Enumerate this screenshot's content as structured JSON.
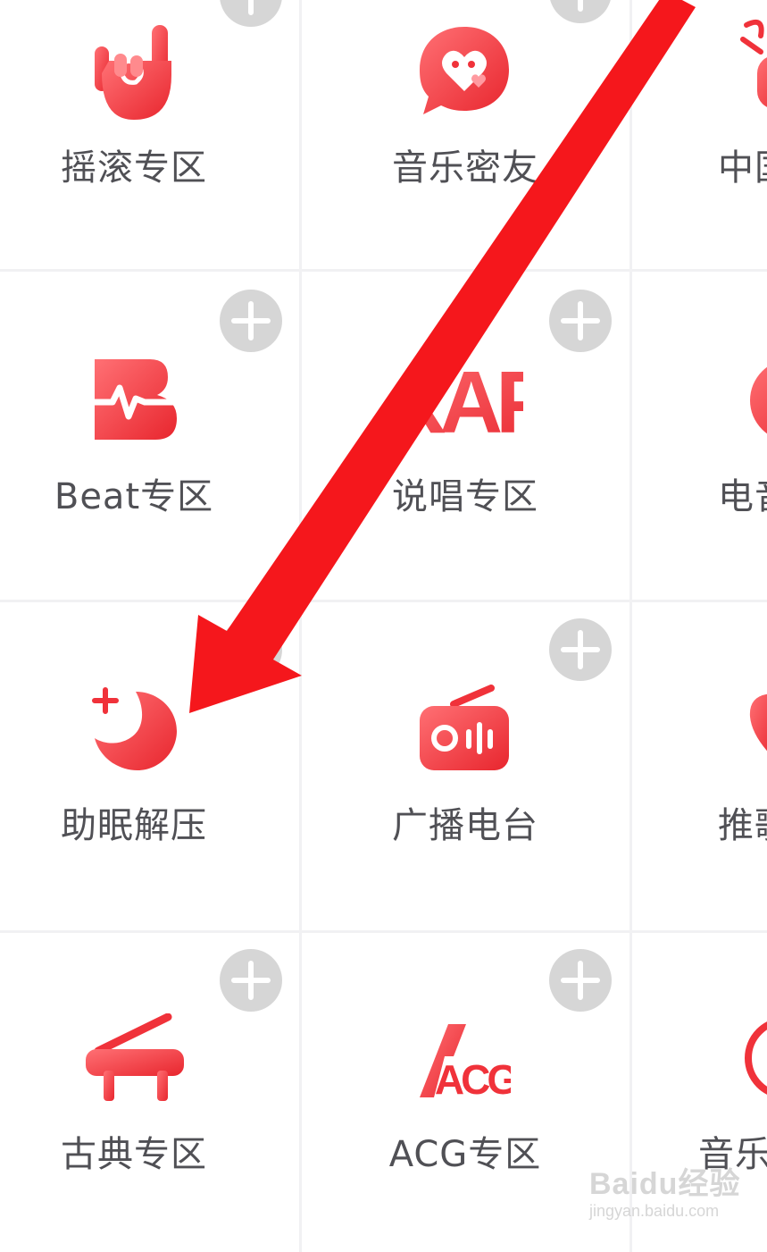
{
  "colors": {
    "accent": "#f0323a",
    "icon_gradient_light": "#ff6b6f",
    "icon_gradient_dark": "#e8262e",
    "add_button": "#d6d6d6",
    "label": "#505055",
    "arrow": "#f5171c"
  },
  "tiles": [
    {
      "label": "摇滚专区",
      "icon": "rock-hand-icon"
    },
    {
      "label": "音乐密友",
      "icon": "heart-chat-icon"
    },
    {
      "label": "中国",
      "icon": "chinese-music-icon"
    },
    {
      "label": "Beat专区",
      "icon": "beat-pulse-icon"
    },
    {
      "label": "说唱专区",
      "icon": "rap-text-icon"
    },
    {
      "label": "电音",
      "icon": "electronic-icon"
    },
    {
      "label": "助眠解压",
      "icon": "moon-sleep-icon"
    },
    {
      "label": "广播电台",
      "icon": "radio-icon"
    },
    {
      "label": "推歌",
      "icon": "recommend-icon"
    },
    {
      "label": "古典专区",
      "icon": "piano-icon"
    },
    {
      "label": "ACG专区",
      "icon": "acg-logo-icon"
    },
    {
      "label": "音乐",
      "icon": "music-icon"
    }
  ],
  "icon_texts": {
    "rap": "RAP",
    "acg": "ACG"
  },
  "add_button_icon": "plus-icon",
  "annotation": {
    "icon": "red-arrow-icon",
    "target": "助眠解压"
  },
  "watermark": {
    "brand": "Baidu经验",
    "sub": "jingyan.baidu.com"
  }
}
